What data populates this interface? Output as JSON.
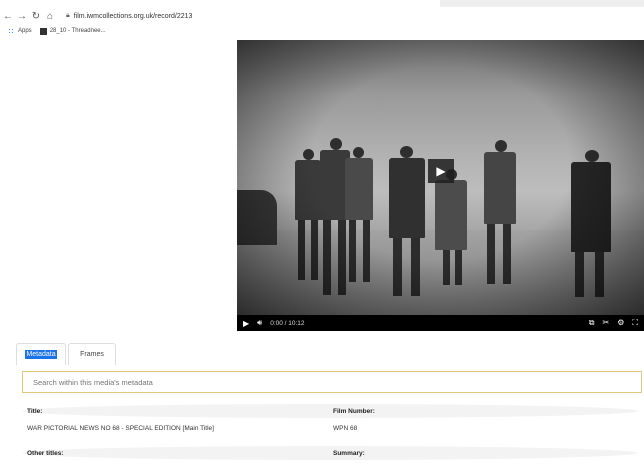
{
  "browser": {
    "url": "film.iwmcollections.org.uk/record/2213",
    "bookmarks": [
      {
        "label": "Apps",
        "icon": "apps-grid-icon"
      },
      {
        "label": "28_10 - Threadnee...",
        "icon": "pdf-icon"
      }
    ]
  },
  "video": {
    "time_current": "0:00",
    "time_total": "10:12",
    "time_display": "0:00 / 10:12"
  },
  "tabs": [
    {
      "label": "Metadata",
      "active": true
    },
    {
      "label": "Frames",
      "active": false
    }
  ],
  "search": {
    "placeholder": "Search within this media's metadata"
  },
  "metadata": {
    "title_label": "Title:",
    "title_value": "WAR PICTORIAL NEWS NO 68 - SPECIAL EDITION [Main Title]",
    "film_number_label": "Film Number:",
    "film_number_value": "WPN 68",
    "other_titles_label": "Other titles:",
    "summary_label": "Summary:"
  },
  "colors": {
    "accent": "#1a73e8",
    "search_border": "#e2c878"
  }
}
